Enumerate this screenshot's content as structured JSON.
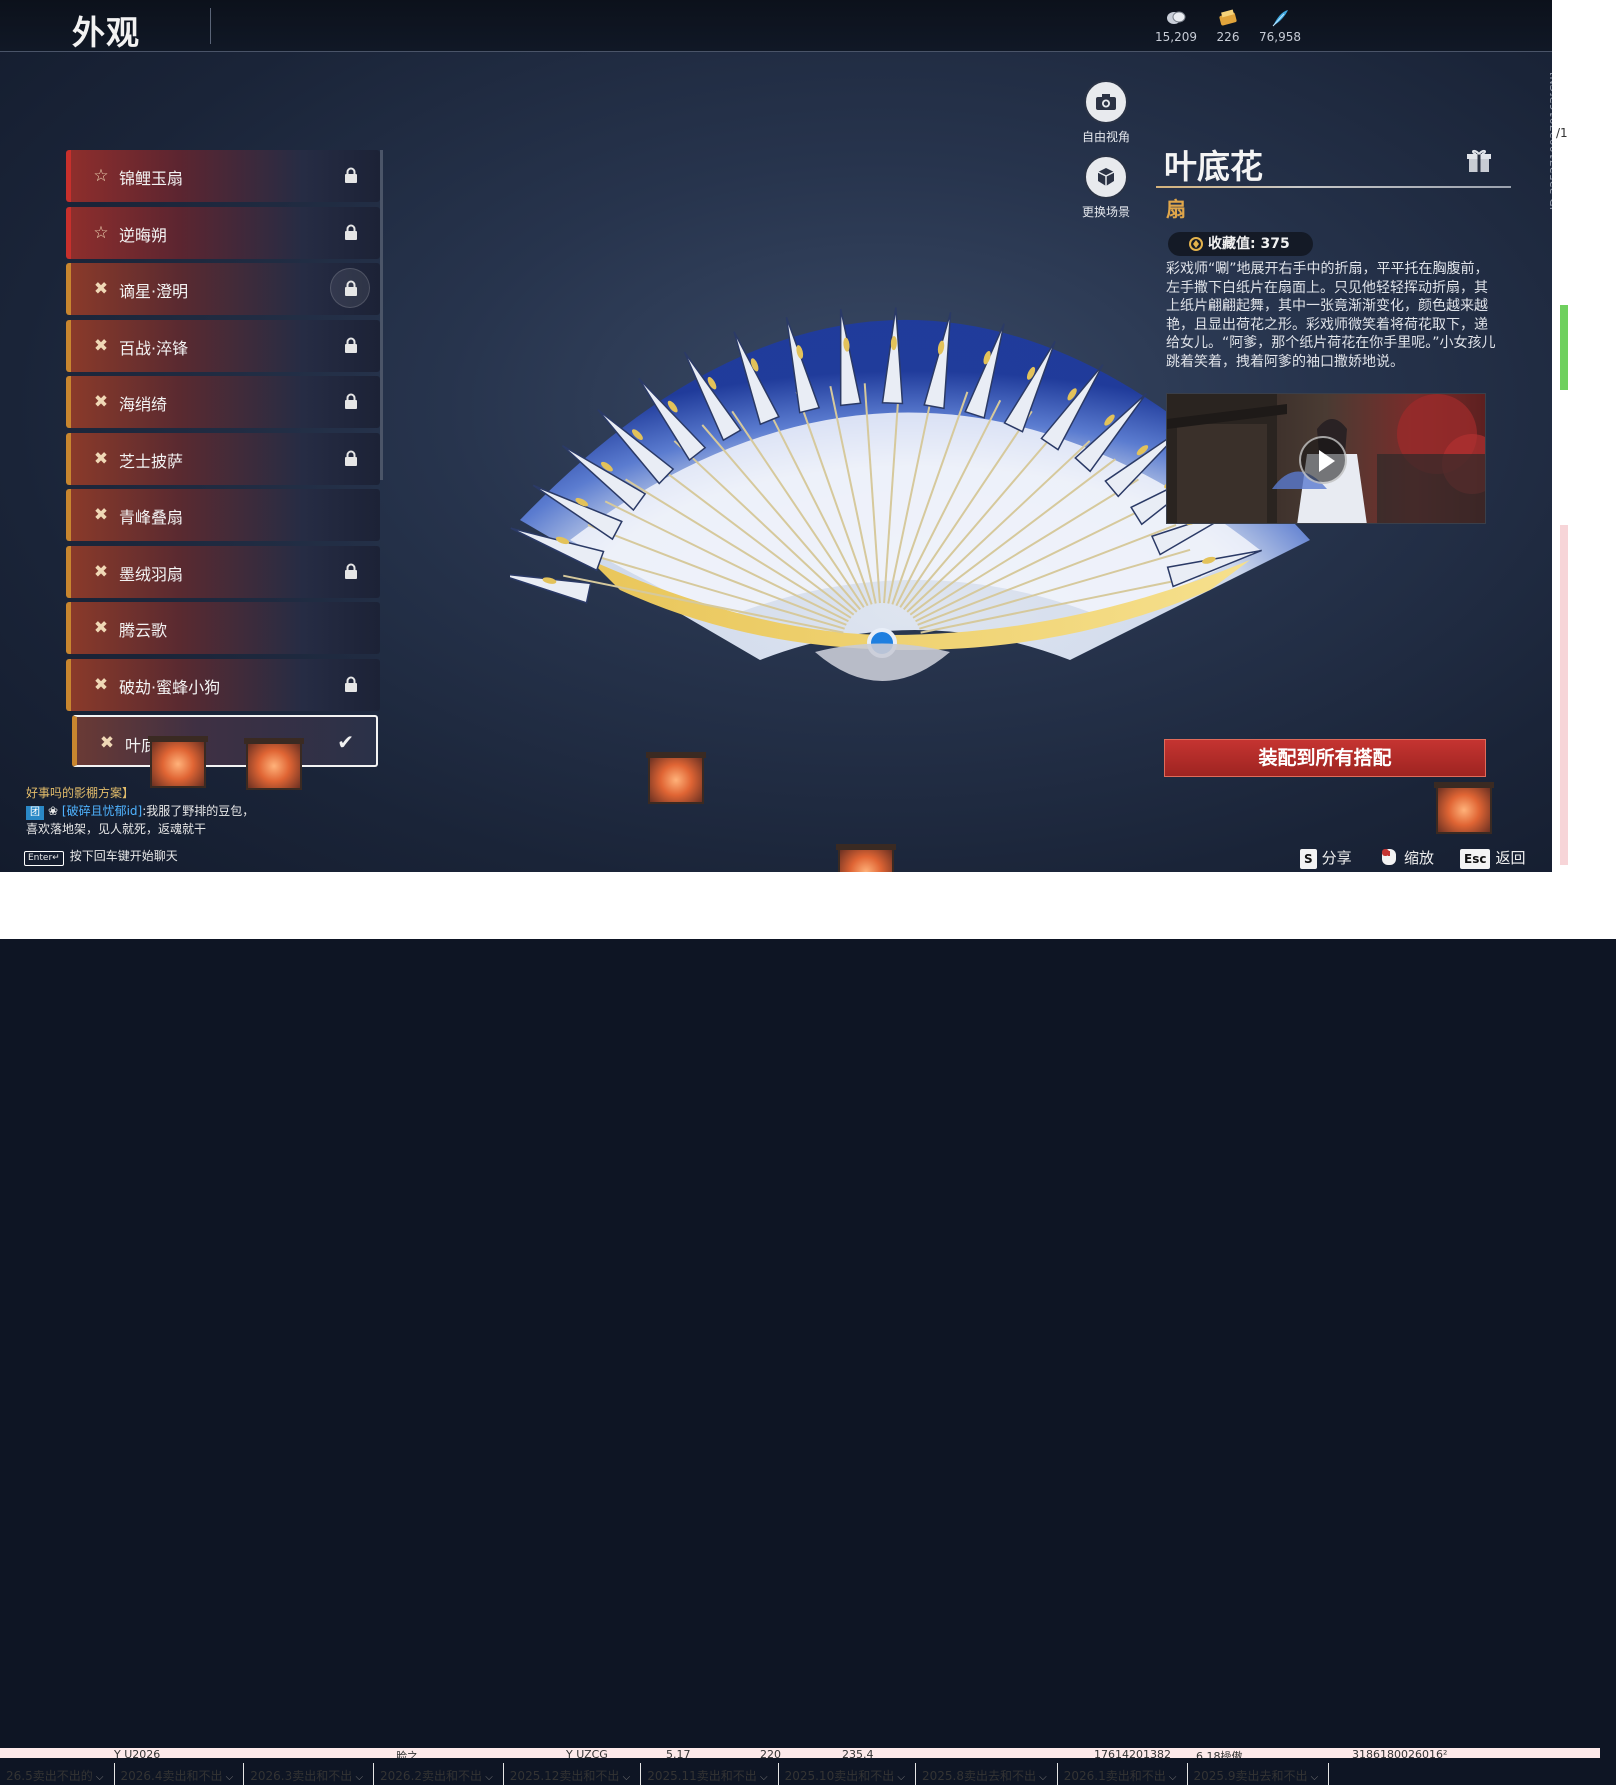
{
  "header": {
    "title": "外观",
    "currencies": [
      {
        "icon": "silver-coin-icon",
        "value": "15,209"
      },
      {
        "icon": "ticket-icon",
        "value": "226"
      },
      {
        "icon": "feather-icon",
        "value": "76,958"
      }
    ]
  },
  "items": [
    {
      "label": "锦鲤玉扇",
      "icon": "star-outline-icon",
      "locked": true,
      "rarity": "red"
    },
    {
      "label": "逆晦朔",
      "icon": "star-outline-icon",
      "locked": true,
      "rarity": "red"
    },
    {
      "label": "谪星·澄明",
      "icon": "cross-flower-icon",
      "locked": true,
      "rarity": "gold"
    },
    {
      "label": "百战·淬锋",
      "icon": "cross-flower-icon",
      "locked": true,
      "rarity": "gold"
    },
    {
      "label": "海绡绮",
      "icon": "cross-flower-icon",
      "locked": true,
      "rarity": "gold"
    },
    {
      "label": "芝士披萨",
      "icon": "cross-flower-icon",
      "locked": true,
      "rarity": "gold"
    },
    {
      "label": "青峰叠扇",
      "icon": "cross-flower-icon",
      "locked": false,
      "rarity": "gold"
    },
    {
      "label": "墨绒羽扇",
      "icon": "cross-flower-icon",
      "locked": true,
      "rarity": "gold"
    },
    {
      "label": "腾云歌",
      "icon": "cross-flower-icon",
      "locked": false,
      "rarity": "gold"
    },
    {
      "label": "破劫·蜜蜂小狗",
      "icon": "cross-flower-icon",
      "locked": true,
      "rarity": "gold"
    },
    {
      "label": "叶底花",
      "icon": "cross-flower-icon",
      "locked": false,
      "rarity": "gold",
      "selected": true
    }
  ],
  "camera": {
    "free_view": "自由视角",
    "change_scene": "更换场景"
  },
  "detail": {
    "name": "叶底花",
    "type": "扇",
    "collect": "收藏值: 375",
    "description": "彩戏师“唰”地展开右手中的折扇，平平托在胸腹前，左手撒下白纸片在扇面上。只见他轻轻挥动折扇，其上纸片翩翩起舞，其中一张竟渐渐变化，颜色越来越艳，且显出荷花之形。彩戏师微笑着将荷花取下，递给女儿。“阿爹，那个纸片荷花在你手里呢。”小女孩儿跳着笑着，拽着阿爹的袖口撒娇地说。",
    "equip_all": "装配到所有搭配",
    "side_id": "ID:3252710027016З[CN]"
  },
  "chat": {
    "tip": "好事吗的影棚方案】",
    "tag": "团",
    "player": "[破碎且忧郁id]",
    "message_1": ":我服了野排的豆包，",
    "message_2": "喜欢落地架，见人就死，返魂就干",
    "enter_key": "Enter↵",
    "enter_hint": "按下回车键开始聊天"
  },
  "hotkeys": [
    {
      "key": "S",
      "label": "分享"
    },
    {
      "key": "",
      "label": "缩放"
    },
    {
      "key": "Esc",
      "label": "返回"
    }
  ],
  "sheet": {
    "row": [
      "Y U2026",
      "脸之",
      "Y UZCG",
      "5.17",
      "220",
      "235.4",
      "17614201382",
      "6.18操傲",
      "3186180026016²"
    ],
    "tabs": [
      "26.5卖出不出的",
      "2026.4卖出和不出",
      "2026.3卖出和不出",
      "2026.2卖出和不出",
      "2025.12卖出和不出",
      "2025.11卖出和不出",
      "2025.10卖出和不出",
      "2025.8卖出去和不出",
      "2026.1卖出和不出",
      "2025.9卖出去和不出"
    ]
  },
  "colors": {
    "accent_red": "#c53431",
    "gold": "#e0a64a",
    "bg": "#27344d"
  }
}
